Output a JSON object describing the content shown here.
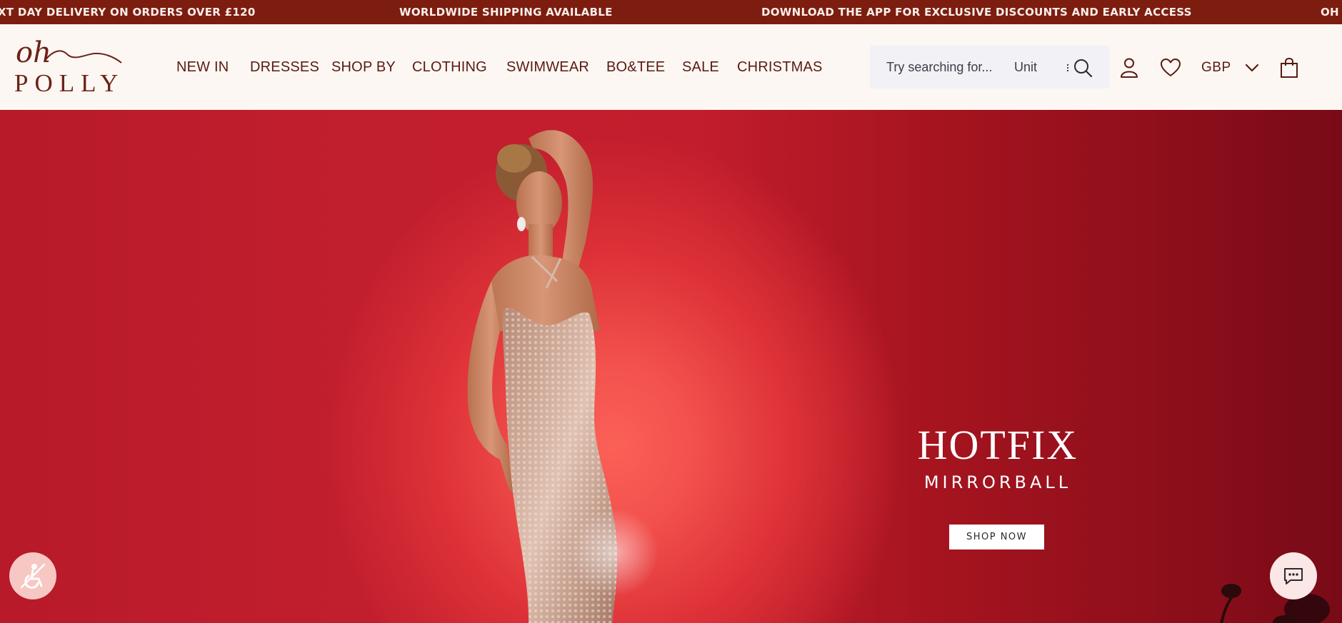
{
  "announcement_bar": {
    "messages": [
      "XT DAY DELIVERY ON ORDERS OVER £120",
      "WORLDWIDE SHIPPING AVAILABLE",
      "DOWNLOAD THE APP FOR EXCLUSIVE DISCOUNTS AND EARLY ACCESS",
      "OH"
    ]
  },
  "brand": {
    "logo_line1": "oh",
    "logo_line2": "POLLY"
  },
  "nav": {
    "items": [
      {
        "label": "NEW IN"
      },
      {
        "label": "DRESSES"
      },
      {
        "label": "SHOP BY"
      },
      {
        "label": "CLOTHING"
      },
      {
        "label": "SWIMWEAR"
      },
      {
        "label": "BO&TEE"
      },
      {
        "label": "SALE"
      },
      {
        "label": "CHRISTMAS"
      }
    ]
  },
  "search": {
    "placeholder": "Try searching for...",
    "hint": "Unit"
  },
  "header_actions": {
    "currency": "GBP",
    "icons": [
      "search-icon",
      "account-icon",
      "wishlist-heart-icon",
      "chevron-down-icon",
      "shopping-bag-icon"
    ]
  },
  "hero": {
    "title": "HOTFIX",
    "subtitle": "MIRRORBALL",
    "cta_label": "SHOP NOW"
  },
  "floating": {
    "accessibility_icon": "accessibility-icon",
    "chat_icon": "chat-icon"
  },
  "colors": {
    "announcement_bg": "#7c1d10",
    "header_bg": "#fcf7f2",
    "brand_text": "#6d2118",
    "hero_red": "#c21f2e"
  }
}
